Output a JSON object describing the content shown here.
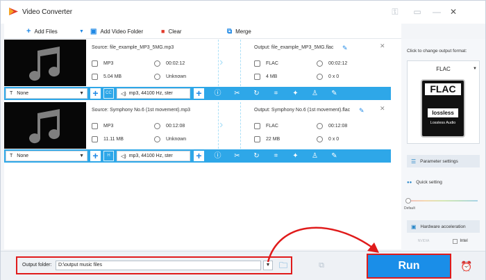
{
  "app": {
    "title": "Video Converter"
  },
  "colors": {
    "accent": "#2ea7e8",
    "run_bg": "#1a8ee8",
    "annotation": "#e01b1b"
  },
  "toolbar": {
    "add_files": "Add Files",
    "add_video_folder": "Add Video Folder",
    "clear": "Clear",
    "merge": "Merge"
  },
  "files": [
    {
      "source": "Source: file_example_MP3_5MG.mp3",
      "src_format": "MP3",
      "src_duration": "00:02:12",
      "src_size": "5.04 MB",
      "src_res": "Unknown",
      "output": "Output: file_example_MP3_5MG.flac",
      "out_format": "FLAC",
      "out_duration": "00:02:12",
      "out_size": "4 MB",
      "out_res": "0 x 0",
      "subtitle": "None",
      "audio": "mp3, 44100 Hz, ster"
    },
    {
      "source": "Source: Symphony No.6 (1st movement).mp3",
      "src_format": "MP3",
      "src_duration": "00:12:08",
      "src_size": "11.11 MB",
      "src_res": "Unknown",
      "output": "Output: Symphony No.6 (1st movement).flac",
      "out_format": "FLAC",
      "out_duration": "00:12:08",
      "out_size": "22 MB",
      "out_res": "0 x 0",
      "subtitle": "None",
      "audio": "mp3, 44100 Hz, ster"
    }
  ],
  "right_panel": {
    "hint": "Click to change output format:",
    "format": "FLAC",
    "badge_top": "FLAC",
    "badge_mid": "lossless",
    "badge_sub": "Lossless Audio",
    "parameter_settings": "Parameter settings",
    "quick_setting": "Quick setting",
    "slider_label": "Default",
    "hardware_acceleration": "Hardware acceleration",
    "nvidia": "NVIDIA",
    "intel": "Intel"
  },
  "bottom": {
    "output_folder_label": "Output folder:",
    "output_folder_value": "D:\\output music files",
    "run": "Run"
  }
}
